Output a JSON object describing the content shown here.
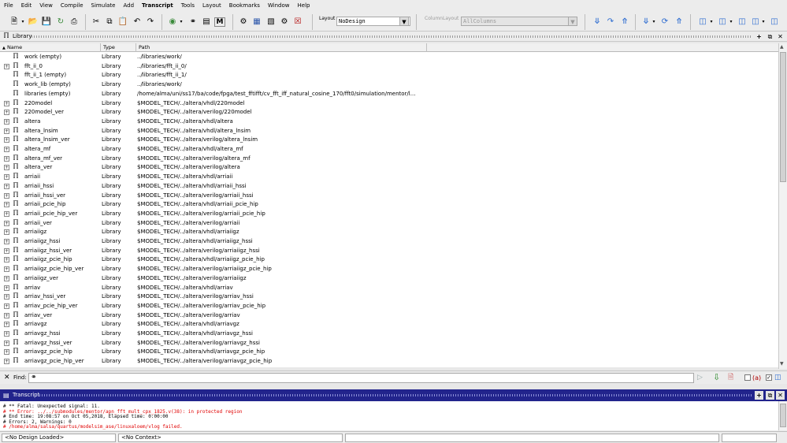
{
  "menu": [
    "File",
    "Edit",
    "View",
    "Compile",
    "Simulate",
    "Add",
    "Transcript",
    "Tools",
    "Layout",
    "Bookmarks",
    "Window",
    "Help"
  ],
  "toolbar": {
    "layout_label": "Layout",
    "layout_value": "NoDesign",
    "column_layout_label": "ColumnLayout",
    "column_layout_value": "AllColumns"
  },
  "library_panel": {
    "title": "Library",
    "columns": {
      "name": "Name",
      "type": "Type",
      "path": "Path"
    },
    "rows": [
      {
        "name": "work  (empty)",
        "type": "Library",
        "path": "../libraries/work/",
        "expandable": false
      },
      {
        "name": "fft_ii_0",
        "type": "Library",
        "path": "../libraries/fft_ii_0/",
        "expandable": true
      },
      {
        "name": "fft_ii_1  (empty)",
        "type": "Library",
        "path": "../libraries/fft_ii_1/",
        "expandable": false
      },
      {
        "name": "work_lib  (empty)",
        "type": "Library",
        "path": "../libraries/work/",
        "expandable": false
      },
      {
        "name": "libraries  (empty)",
        "type": "Library",
        "path": "/home/alma/uni/ss17/ba/code/fpga/test_fftifft/cv_fft_iff_natural_cosine_170/fft0/simulation/mentor/l...",
        "expandable": false
      },
      {
        "name": "220model",
        "type": "Library",
        "path": "$MODEL_TECH/../altera/vhdl/220model",
        "expandable": true
      },
      {
        "name": "220model_ver",
        "type": "Library",
        "path": "$MODEL_TECH/../altera/verilog/220model",
        "expandable": true
      },
      {
        "name": "altera",
        "type": "Library",
        "path": "$MODEL_TECH/../altera/vhdl/altera",
        "expandable": true
      },
      {
        "name": "altera_lnsim",
        "type": "Library",
        "path": "$MODEL_TECH/../altera/vhdl/altera_lnsim",
        "expandable": true
      },
      {
        "name": "altera_lnsim_ver",
        "type": "Library",
        "path": "$MODEL_TECH/../altera/verilog/altera_lnsim",
        "expandable": true
      },
      {
        "name": "altera_mf",
        "type": "Library",
        "path": "$MODEL_TECH/../altera/vhdl/altera_mf",
        "expandable": true
      },
      {
        "name": "altera_mf_ver",
        "type": "Library",
        "path": "$MODEL_TECH/../altera/verilog/altera_mf",
        "expandable": true
      },
      {
        "name": "altera_ver",
        "type": "Library",
        "path": "$MODEL_TECH/../altera/verilog/altera",
        "expandable": true
      },
      {
        "name": "arriaii",
        "type": "Library",
        "path": "$MODEL_TECH/../altera/vhdl/arriaii",
        "expandable": true
      },
      {
        "name": "arriaii_hssi",
        "type": "Library",
        "path": "$MODEL_TECH/../altera/vhdl/arriaii_hssi",
        "expandable": true
      },
      {
        "name": "arriaii_hssi_ver",
        "type": "Library",
        "path": "$MODEL_TECH/../altera/verilog/arriaii_hssi",
        "expandable": true
      },
      {
        "name": "arriaii_pcie_hip",
        "type": "Library",
        "path": "$MODEL_TECH/../altera/vhdl/arriaii_pcie_hip",
        "expandable": true
      },
      {
        "name": "arriaii_pcie_hip_ver",
        "type": "Library",
        "path": "$MODEL_TECH/../altera/verilog/arriaii_pcie_hip",
        "expandable": true
      },
      {
        "name": "arriaii_ver",
        "type": "Library",
        "path": "$MODEL_TECH/../altera/verilog/arriaii",
        "expandable": true
      },
      {
        "name": "arriaiigz",
        "type": "Library",
        "path": "$MODEL_TECH/../altera/vhdl/arriaiigz",
        "expandable": true
      },
      {
        "name": "arriaiigz_hssi",
        "type": "Library",
        "path": "$MODEL_TECH/../altera/vhdl/arriaiigz_hssi",
        "expandable": true
      },
      {
        "name": "arriaiigz_hssi_ver",
        "type": "Library",
        "path": "$MODEL_TECH/../altera/verilog/arriaiigz_hssi",
        "expandable": true
      },
      {
        "name": "arriaiigz_pcie_hip",
        "type": "Library",
        "path": "$MODEL_TECH/../altera/vhdl/arriaiigz_pcie_hip",
        "expandable": true
      },
      {
        "name": "arriaiigz_pcie_hip_ver",
        "type": "Library",
        "path": "$MODEL_TECH/../altera/verilog/arriaiigz_pcie_hip",
        "expandable": true
      },
      {
        "name": "arriaiigz_ver",
        "type": "Library",
        "path": "$MODEL_TECH/../altera/verilog/arriaiigz",
        "expandable": true
      },
      {
        "name": "arriav",
        "type": "Library",
        "path": "$MODEL_TECH/../altera/vhdl/arriav",
        "expandable": true
      },
      {
        "name": "arriav_hssi_ver",
        "type": "Library",
        "path": "$MODEL_TECH/../altera/verilog/arriav_hssi",
        "expandable": true
      },
      {
        "name": "arriav_pcie_hip_ver",
        "type": "Library",
        "path": "$MODEL_TECH/../altera/verilog/arriav_pcie_hip",
        "expandable": true
      },
      {
        "name": "arriav_ver",
        "type": "Library",
        "path": "$MODEL_TECH/../altera/verilog/arriav",
        "expandable": true
      },
      {
        "name": "arriavgz",
        "type": "Library",
        "path": "$MODEL_TECH/../altera/vhdl/arriavgz",
        "expandable": true
      },
      {
        "name": "arriavgz_hssi",
        "type": "Library",
        "path": "$MODEL_TECH/../altera/vhdl/arriavgz_hssi",
        "expandable": true
      },
      {
        "name": "arriavgz_hssi_ver",
        "type": "Library",
        "path": "$MODEL_TECH/../altera/verilog/arriavgz_hssi",
        "expandable": true
      },
      {
        "name": "arriavgz_pcie_hip",
        "type": "Library",
        "path": "$MODEL_TECH/../altera/vhdl/arriavgz_pcie_hip",
        "expandable": true
      },
      {
        "name": "arriavgz_pcie_hip_ver",
        "type": "Library",
        "path": "$MODEL_TECH/../altera/verilog/arriavgz_pcie_hip",
        "expandable": true
      }
    ]
  },
  "find_bar": {
    "label": "Find:"
  },
  "transcript": {
    "title": "Transcript",
    "lines": [
      {
        "text": "# ** Fatal: Unexpected signal: 11.",
        "color": "#000000"
      },
      {
        "text": "# ** Error: ../../submodules/mentor/apn_fft_mult_cpx_1825.v(38): in protected region",
        "color": "#e00000"
      },
      {
        "text": "# End time: 19:08:57 on Oct 05,2018, Elapsed time: 0:00:00",
        "color": "#000000"
      },
      {
        "text": "# Errors: 2, Warnings: 0",
        "color": "#000000"
      },
      {
        "text": "# /home/alma/salsa/quartus/modelsim_ase/linuxaloem/vlog failed.",
        "color": "#e00000"
      }
    ]
  },
  "status": {
    "design": "<No Design Loaded>",
    "context": "<No Context>"
  },
  "colors": {
    "transcript_titlebar": "#22248c",
    "error_text": "#e00000"
  }
}
